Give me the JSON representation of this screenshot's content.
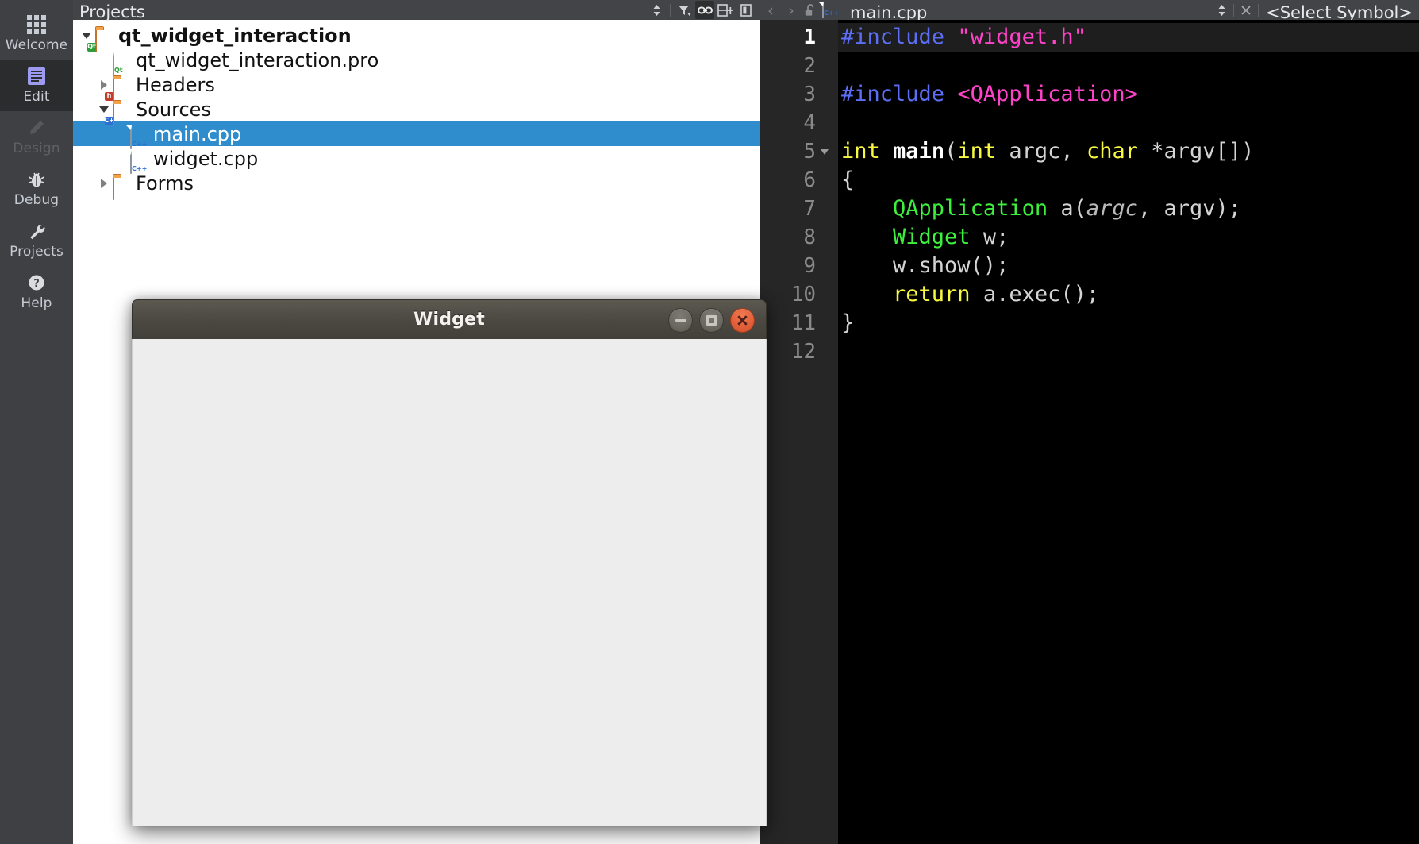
{
  "modes": [
    {
      "label": "Welcome",
      "icon": "grid-icon",
      "active": false,
      "dim": false
    },
    {
      "label": "Edit",
      "icon": "document-icon",
      "active": true,
      "dim": false
    },
    {
      "label": "Design",
      "icon": "pencil-icon",
      "active": false,
      "dim": true
    },
    {
      "label": "Debug",
      "icon": "bug-icon",
      "active": false,
      "dim": false
    },
    {
      "label": "Projects",
      "icon": "wrench-icon",
      "active": false,
      "dim": false
    },
    {
      "label": "Help",
      "icon": "question-icon",
      "active": false,
      "dim": false
    }
  ],
  "projects_panel": {
    "title": "Projects",
    "tools": [
      {
        "name": "sync-selection-icon",
        "glyph": "↕"
      },
      {
        "name": "filter-icon",
        "glyph": "filter"
      },
      {
        "name": "link-icon",
        "glyph": "link"
      },
      {
        "name": "split-add-icon",
        "glyph": "split"
      },
      {
        "name": "close-split-icon",
        "glyph": "closesplit"
      }
    ],
    "tree": [
      {
        "label": "qt_widget_interaction",
        "indent": 0,
        "arrow": "down",
        "icon": "folder-qt",
        "bold": true,
        "selected": false
      },
      {
        "label": "qt_widget_interaction.pro",
        "indent": 1,
        "arrow": "none",
        "icon": "file-qt",
        "bold": false,
        "selected": false
      },
      {
        "label": "Headers",
        "indent": 1,
        "arrow": "right",
        "icon": "folder-h",
        "bold": false,
        "selected": false
      },
      {
        "label": "Sources",
        "indent": 1,
        "arrow": "down",
        "icon": "folder-cpp",
        "bold": false,
        "selected": false
      },
      {
        "label": "main.cpp",
        "indent": 2,
        "arrow": "none",
        "icon": "file-cpp",
        "bold": false,
        "selected": true
      },
      {
        "label": "widget.cpp",
        "indent": 2,
        "arrow": "none",
        "icon": "file-cpp",
        "bold": false,
        "selected": false
      },
      {
        "label": "Forms",
        "indent": 1,
        "arrow": "right",
        "icon": "folder-ui",
        "bold": false,
        "selected": false
      }
    ]
  },
  "editor": {
    "document_name": "main.cpp",
    "symbol_selector": "<Select Symbol>",
    "nav_back": "‹",
    "nav_forward": "›",
    "lock_icon": "unlocked-icon",
    "lines": [
      {
        "n": "1",
        "fold": false,
        "current": true,
        "tokens": [
          {
            "t": "#include ",
            "c": "pre"
          },
          {
            "t": "\"widget.h\"",
            "c": "str"
          }
        ]
      },
      {
        "n": "2",
        "fold": false,
        "current": false,
        "tokens": []
      },
      {
        "n": "3",
        "fold": false,
        "current": false,
        "tokens": [
          {
            "t": "#include ",
            "c": "pre"
          },
          {
            "t": "<QApplication>",
            "c": "str"
          }
        ]
      },
      {
        "n": "4",
        "fold": false,
        "current": false,
        "tokens": []
      },
      {
        "n": "5",
        "fold": true,
        "current": false,
        "tokens": [
          {
            "t": "int",
            "c": "kw"
          },
          {
            "t": " ",
            "c": "punc"
          },
          {
            "t": "main",
            "c": "fn"
          },
          {
            "t": "(",
            "c": "punc"
          },
          {
            "t": "int",
            "c": "kw"
          },
          {
            "t": " ",
            "c": "punc"
          },
          {
            "t": "argc",
            "c": "id"
          },
          {
            "t": ", ",
            "c": "punc"
          },
          {
            "t": "char",
            "c": "kw"
          },
          {
            "t": " *",
            "c": "punc"
          },
          {
            "t": "argv",
            "c": "id"
          },
          {
            "t": "[])",
            "c": "punc"
          }
        ]
      },
      {
        "n": "6",
        "fold": false,
        "current": false,
        "tokens": [
          {
            "t": "{",
            "c": "punc"
          }
        ]
      },
      {
        "n": "7",
        "fold": false,
        "current": false,
        "tokens": [
          {
            "t": "    ",
            "c": "punc"
          },
          {
            "t": "QApplication",
            "c": "type"
          },
          {
            "t": " a(",
            "c": "id"
          },
          {
            "t": "argc",
            "c": "param"
          },
          {
            "t": ", ",
            "c": "id"
          },
          {
            "t": "argv",
            "c": "id"
          },
          {
            "t": ");",
            "c": "id"
          }
        ]
      },
      {
        "n": "8",
        "fold": false,
        "current": false,
        "tokens": [
          {
            "t": "    ",
            "c": "punc"
          },
          {
            "t": "Widget",
            "c": "type"
          },
          {
            "t": " w;",
            "c": "id"
          }
        ]
      },
      {
        "n": "9",
        "fold": false,
        "current": false,
        "tokens": [
          {
            "t": "    w.show();",
            "c": "id"
          }
        ]
      },
      {
        "n": "10",
        "fold": false,
        "current": false,
        "tokens": [
          {
            "t": "    ",
            "c": "punc"
          },
          {
            "t": "return",
            "c": "kw"
          },
          {
            "t": " a.exec();",
            "c": "id"
          }
        ]
      },
      {
        "n": "11",
        "fold": false,
        "current": false,
        "tokens": [
          {
            "t": "}",
            "c": "punc"
          }
        ]
      },
      {
        "n": "12",
        "fold": false,
        "current": false,
        "tokens": []
      }
    ]
  },
  "widget_window": {
    "title": "Widget",
    "buttons": [
      {
        "name": "minimize-button",
        "kind": "min"
      },
      {
        "name": "maximize-button",
        "kind": "max"
      },
      {
        "name": "close-button",
        "kind": "close"
      }
    ]
  },
  "colors": {
    "selection_blue": "#2f8dcd",
    "chrome_gray": "#434447",
    "sidebar_gray": "#3f4043",
    "editor_bg": "#000000",
    "gutter_bg": "#262626",
    "close_orange": "#e2603a",
    "type_green": "#3ef03e",
    "keyword_yellow": "#f8f840",
    "string_magenta": "#ff43c8",
    "preproc_blue": "#5b6ef5"
  }
}
